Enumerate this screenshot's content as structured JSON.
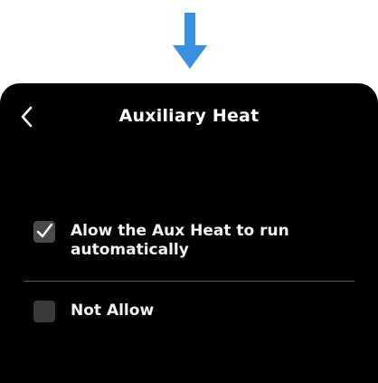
{
  "header": {
    "title": "Auxiliary Heat",
    "back_icon": "chevron-left-icon"
  },
  "options": [
    {
      "label": "Alow the Aux Heat to run automatically",
      "checked": true
    },
    {
      "label": "Not Allow",
      "checked": false
    }
  ],
  "colors": {
    "arrow": "#3b8fe0",
    "screen_bg": "#000000",
    "text": "#ffffff"
  }
}
